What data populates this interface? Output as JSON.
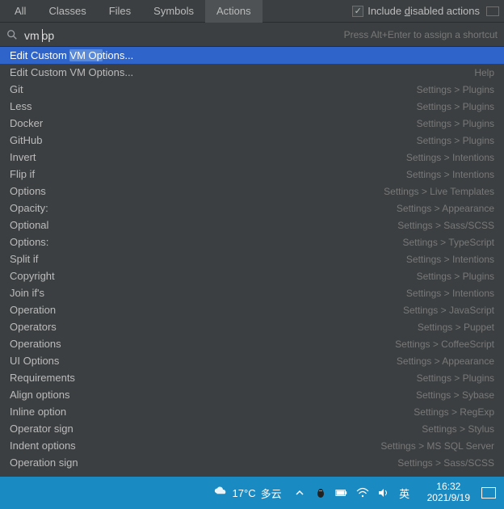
{
  "tabs": [
    {
      "label": "All",
      "active": false
    },
    {
      "label": "Classes",
      "active": false
    },
    {
      "label": "Files",
      "active": false
    },
    {
      "label": "Symbols",
      "active": false
    },
    {
      "label": "Actions",
      "active": true
    }
  ],
  "include_disabled": {
    "checked": true,
    "label_pre": "Include ",
    "label_u": "d",
    "label_post": "isabled actions"
  },
  "search": {
    "value_before_caret": "vm ",
    "value_after_caret": "op",
    "hint": "Press Alt+Enter to assign a shortcut"
  },
  "results": [
    {
      "label_pre": "Edit Custom ",
      "label_hl": "VM Op",
      "label_post": "tions...",
      "path": "",
      "selected": true
    },
    {
      "label": "Edit Custom VM Options...",
      "path": "Help"
    },
    {
      "label": "Git",
      "path": "Settings > Plugins"
    },
    {
      "label": "Less",
      "path": "Settings > Plugins"
    },
    {
      "label": "Docker",
      "path": "Settings > Plugins"
    },
    {
      "label": "GitHub",
      "path": "Settings > Plugins"
    },
    {
      "label": "Invert",
      "path": "Settings > Intentions"
    },
    {
      "label": "Flip if",
      "path": "Settings > Intentions"
    },
    {
      "label": "Options",
      "path": "Settings > Live Templates"
    },
    {
      "label": "Opacity:",
      "path": "Settings > Appearance"
    },
    {
      "label": "Optional",
      "path": "Settings > Sass/SCSS"
    },
    {
      "label": "Options:",
      "path": "Settings > TypeScript"
    },
    {
      "label": "Split if",
      "path": "Settings > Intentions"
    },
    {
      "label": "Copyright",
      "path": "Settings > Plugins"
    },
    {
      "label": "Join if's",
      "path": "Settings > Intentions"
    },
    {
      "label": "Operation",
      "path": "Settings > JavaScript"
    },
    {
      "label": "Operators",
      "path": "Settings > Puppet"
    },
    {
      "label": "Operations",
      "path": "Settings > CoffeeScript"
    },
    {
      "label": "UI Options",
      "path": "Settings > Appearance"
    },
    {
      "label": "Requirements",
      "path": "Settings > Plugins"
    },
    {
      "label": "Align options",
      "path": "Settings > Sybase"
    },
    {
      "label": "Inline option",
      "path": "Settings > RegExp"
    },
    {
      "label": "Operator sign",
      "path": "Settings > Stylus"
    },
    {
      "label": "Indent options",
      "path": "Settings > MS SQL Server"
    },
    {
      "label": "Operation sign",
      "path": "Settings > Sass/SCSS"
    }
  ],
  "taskbar": {
    "weather_temp": "17°C",
    "weather_desc": "多云",
    "ime": "英",
    "time": "16:32",
    "date": "2021/9/19"
  }
}
